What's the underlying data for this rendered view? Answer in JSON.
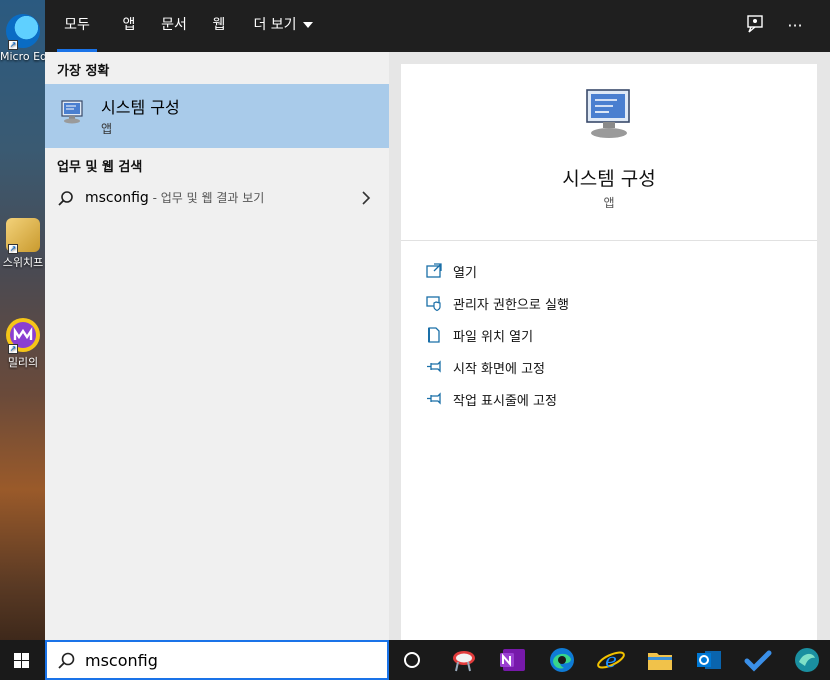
{
  "desktop": {
    "icons": [
      {
        "label": "Micro Ed",
        "name": "edge"
      },
      {
        "label": "스위치프",
        "name": "folder"
      },
      {
        "label": "밀리의",
        "name": "millie"
      }
    ]
  },
  "tabs": [
    {
      "label": "모두",
      "active": true
    },
    {
      "label": "앱"
    },
    {
      "label": "문서"
    },
    {
      "label": "웹"
    },
    {
      "label": "더 보기"
    }
  ],
  "top_icons": [
    "feedback-icon",
    "more-options-icon"
  ],
  "more_label": "···",
  "left": {
    "best_match_header": "가장 정확",
    "best_match": {
      "title": "시스템 구성",
      "subtitle": "앱"
    },
    "web_header": "업무 및 웹 검색",
    "web_result": {
      "query": "msconfig",
      "hint": " - 업무 및 웹 결과 보기"
    }
  },
  "right": {
    "app_title": "시스템 구성",
    "app_subtitle": "앱",
    "actions": [
      {
        "label": "열기",
        "icon": "open-icon"
      },
      {
        "label": "관리자 권한으로 실행",
        "icon": "shield-icon"
      },
      {
        "label": "파일 위치 열기",
        "icon": "file-location-icon"
      },
      {
        "label": "시작 화면에 고정",
        "icon": "pin-icon"
      },
      {
        "label": "작업 표시줄에 고정",
        "icon": "pin-icon"
      }
    ]
  },
  "taskbar": {
    "search_value": "msconfig",
    "apps": [
      "cortana-icon",
      "snip-icon",
      "onenote-icon",
      "edge-icon",
      "ie-icon",
      "file-explorer-icon",
      "outlook-icon",
      "todo-icon",
      "app-icon"
    ]
  },
  "colors": {
    "accent": "#1a73e8",
    "highlight": "#a9cbea",
    "topbar": "#1f1f1f",
    "action_icon": "#1a6fa8"
  }
}
